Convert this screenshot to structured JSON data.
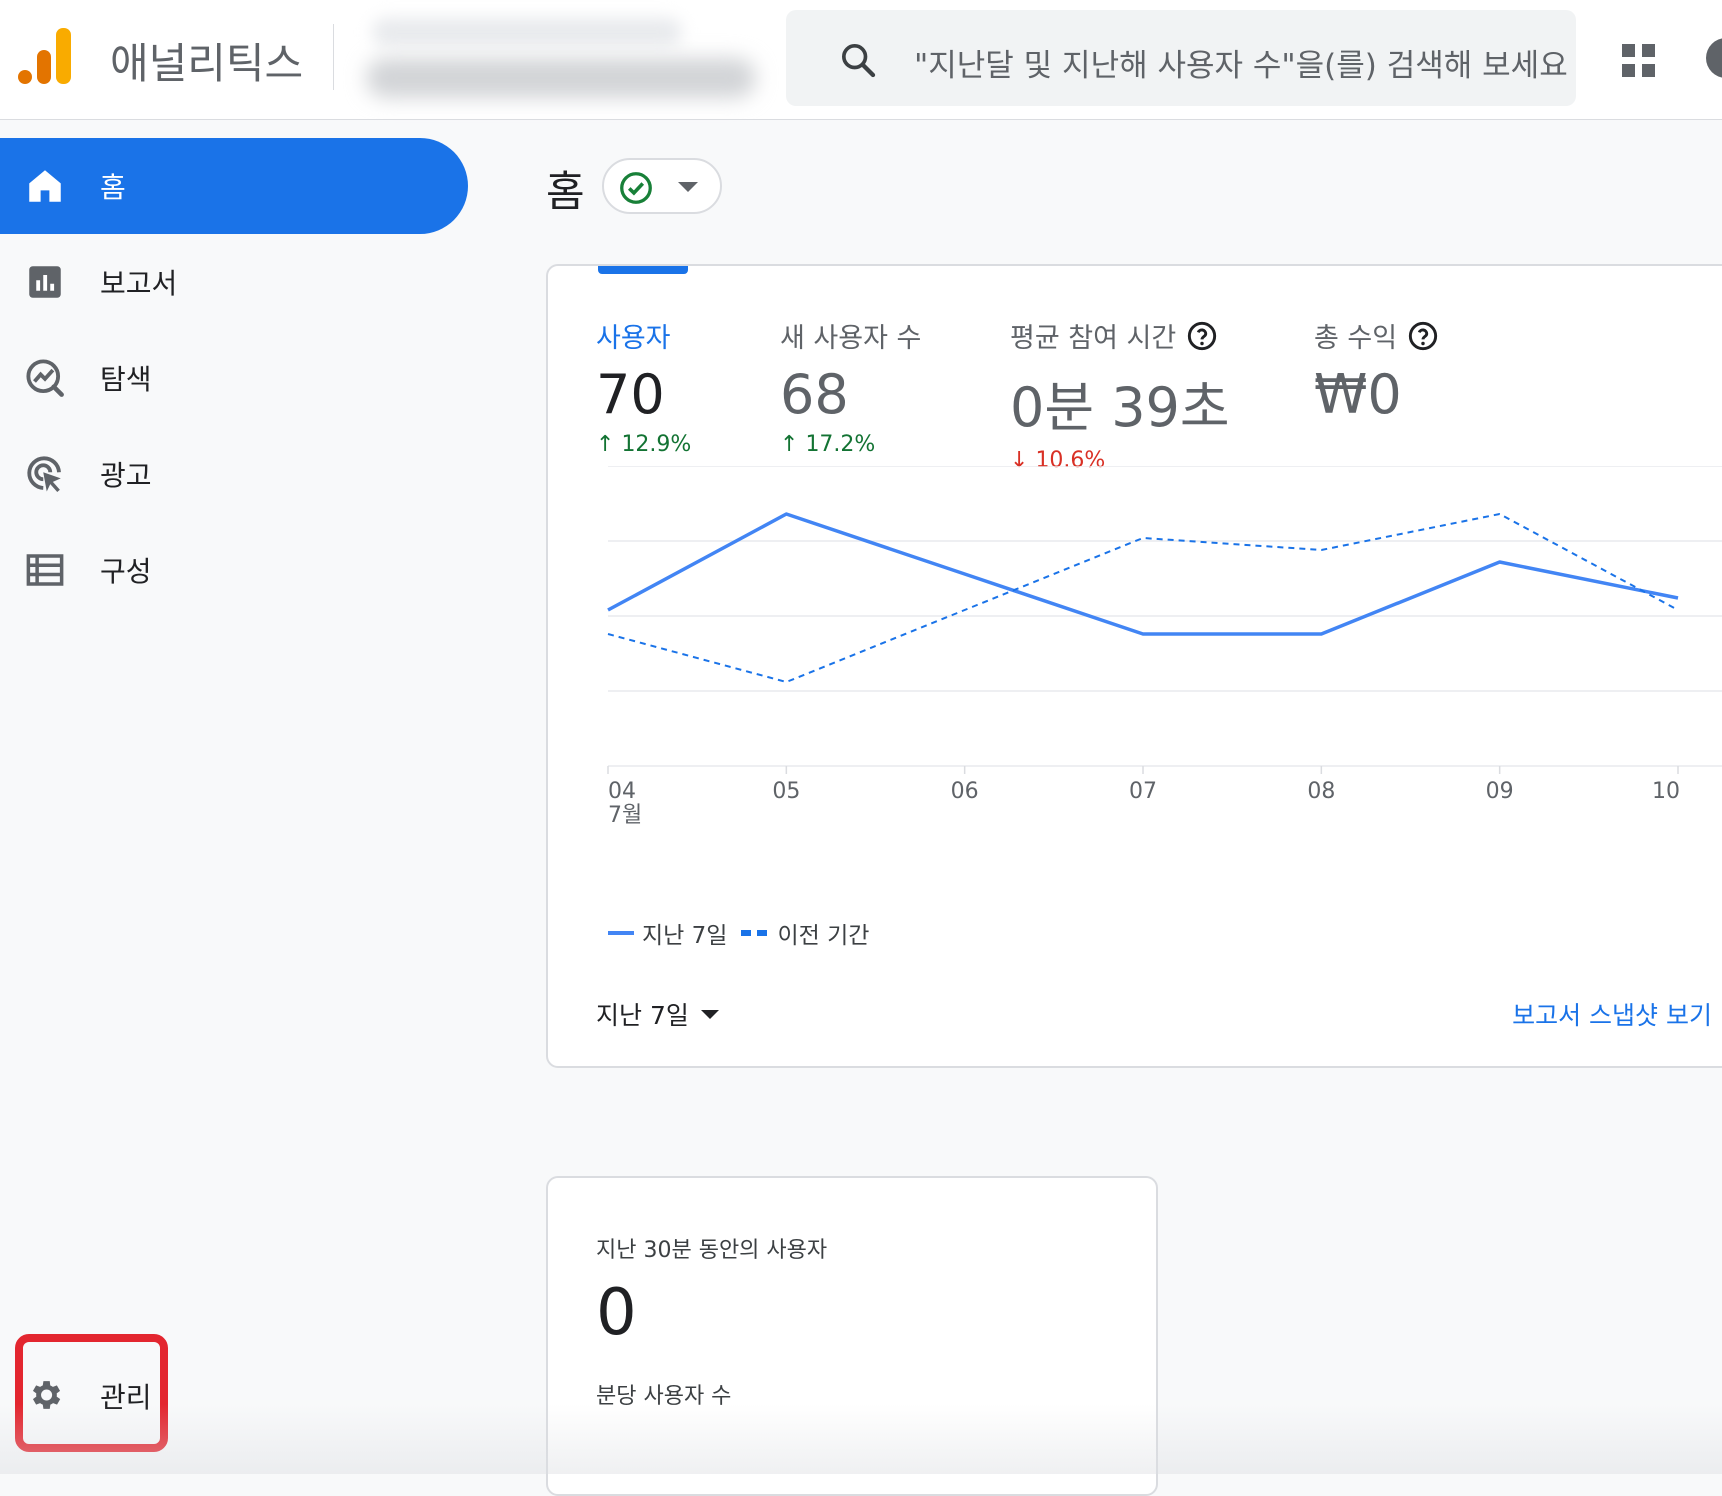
{
  "brand": {
    "name": "애널리틱스"
  },
  "search": {
    "placeholder": "\"지난달 및 지난해 사용자 수\"을(를) 검색해 보세요"
  },
  "sidebar": {
    "items": [
      {
        "label": "홈",
        "icon": "home-icon"
      },
      {
        "label": "보고서",
        "icon": "bar-chart-icon"
      },
      {
        "label": "탐색",
        "icon": "explore-icon"
      },
      {
        "label": "광고",
        "icon": "ads-cursor-icon"
      },
      {
        "label": "구성",
        "icon": "list-icon"
      }
    ],
    "admin_label": "관리"
  },
  "page": {
    "title": "홈"
  },
  "metrics": [
    {
      "label": "사용자",
      "value": "70",
      "delta": "12.9%",
      "direction": "up"
    },
    {
      "label": "새 사용자 수",
      "value": "68",
      "delta": "17.2%",
      "direction": "up"
    },
    {
      "label": "평균 참여 시간",
      "value": "0분 39초",
      "delta": "10.6%",
      "direction": "down"
    },
    {
      "label": "총 수익",
      "value": "₩0",
      "delta": "",
      "direction": "none"
    }
  ],
  "chart_data": {
    "type": "line",
    "x": [
      "04",
      "05",
      "06",
      "07",
      "08",
      "09",
      "10"
    ],
    "x_sub_label": "7월",
    "series": [
      {
        "name": "지난 7일",
        "values": [
          13,
          21,
          16,
          11,
          11,
          17,
          14
        ],
        "style": "solid",
        "color": "#4285f4"
      },
      {
        "name": "이전 기간",
        "values": [
          11,
          7,
          13,
          19,
          18,
          21,
          13
        ],
        "style": "dashed",
        "color": "#1a73e8"
      }
    ],
    "ylim": [
      0,
      25
    ],
    "grid": true
  },
  "legend": {
    "current": "지난 7일",
    "previous": "이전 기간"
  },
  "range_select": {
    "label": "지난 7일"
  },
  "snapshot_link": "보고서 스냅샷 보기",
  "realtime": {
    "title": "지난 30분 동안의 사용자",
    "value": "0",
    "subtitle": "분당 사용자 수"
  },
  "colors": {
    "accent": "#1a73e8",
    "positive": "#137333",
    "negative": "#d93025",
    "logo_dark": "#e37400",
    "logo_light": "#f9ab00"
  }
}
